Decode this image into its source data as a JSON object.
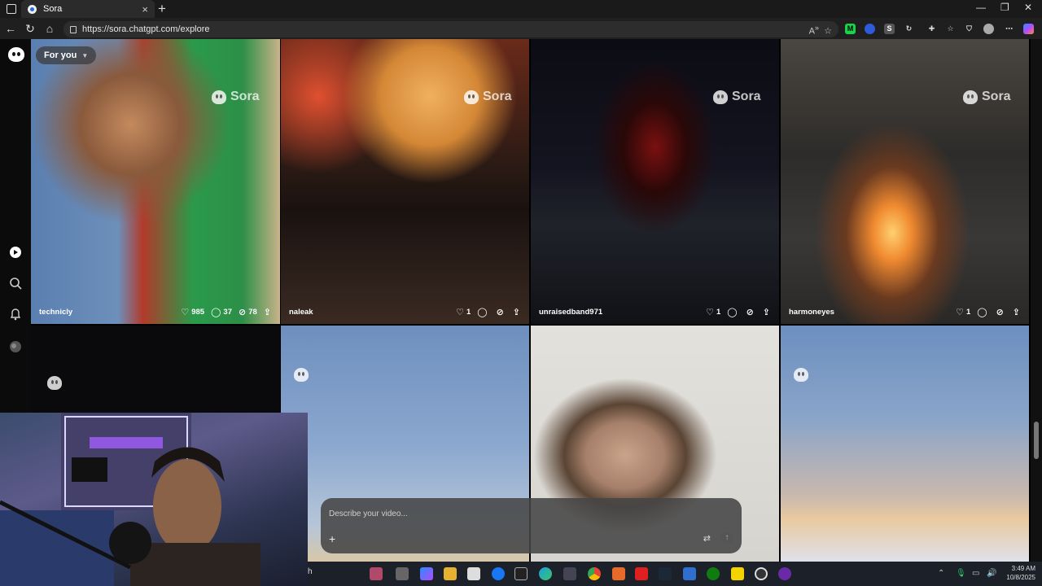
{
  "browser": {
    "tab_title": "Sora",
    "url": "https://sora.chatgpt.com/explore"
  },
  "feed": {
    "filter_label": "For you",
    "watermark": "Sora",
    "posts": [
      {
        "user": "technicly",
        "likes": "985",
        "comments": "37",
        "remixes": "78"
      },
      {
        "user": "naleak",
        "likes": "1",
        "comments": "",
        "remixes": ""
      },
      {
        "user": "unraisedband971",
        "likes": "1",
        "comments": "",
        "remixes": ""
      },
      {
        "user": "harmoneyes",
        "likes": "1",
        "comments": "",
        "remixes": ""
      }
    ]
  },
  "composer": {
    "placeholder": "Describe your video..."
  },
  "taskbar": {
    "search_fragment": "h",
    "time": "3:49 AM",
    "date": "10/8/2025"
  },
  "colors": {
    "accent_sora": "#ffffff",
    "page_bg": "#000000",
    "browser_chrome": "#1f1f1f"
  },
  "icons": [
    "home-icon",
    "search-icon",
    "bell-icon",
    "avatar-icon",
    "heart-icon",
    "comment-icon",
    "remix-icon",
    "share-icon",
    "plus-icon",
    "settings-icon",
    "send-icon"
  ]
}
